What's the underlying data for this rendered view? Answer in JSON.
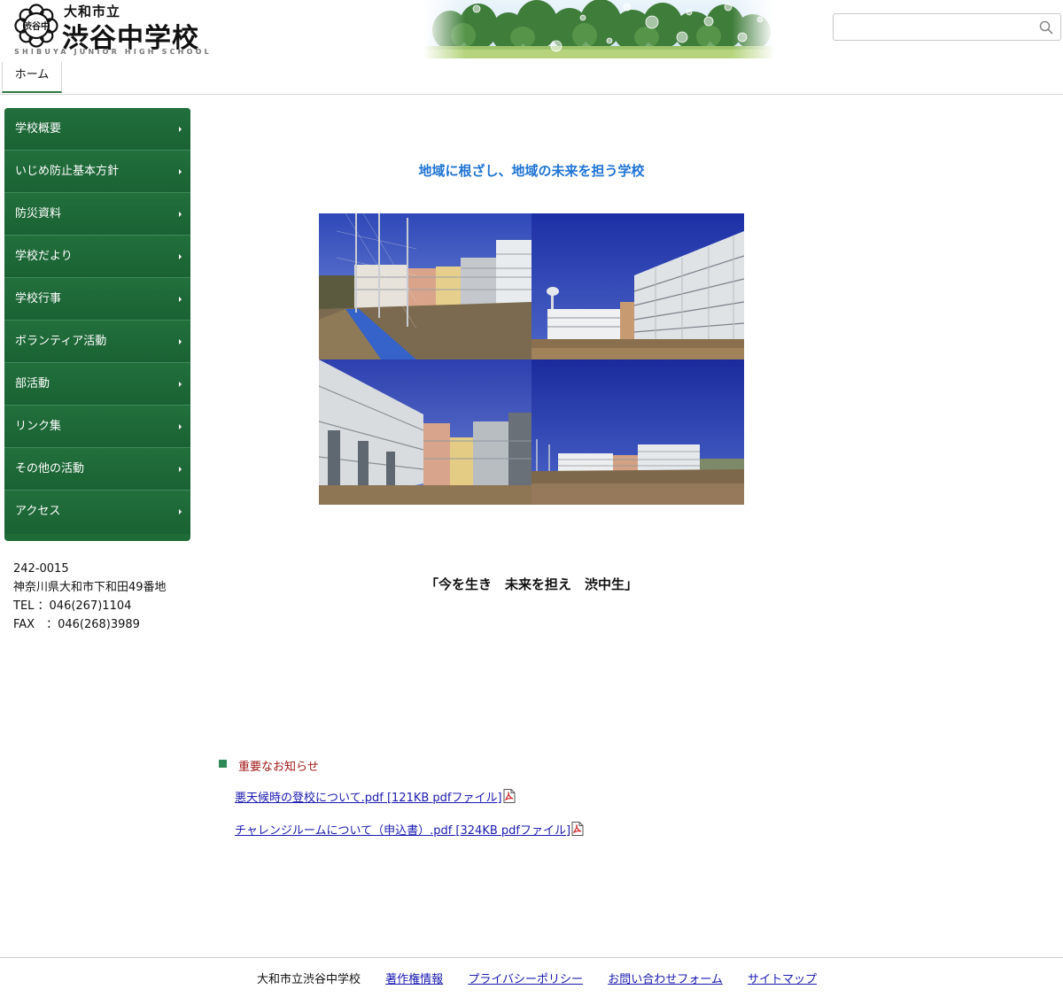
{
  "header": {
    "logo_city": "大和市立",
    "logo_school": "渋谷中学校",
    "logo_english": "SHIBUYA JUNIOR HIGH SCHOOL",
    "emblem_text": "渋谷中",
    "search_placeholder": "",
    "search_icon": "search-icon"
  },
  "nav": {
    "tabs": [
      {
        "label": "ホーム",
        "active": true
      }
    ]
  },
  "sidebar": {
    "items": [
      {
        "label": "学校概要"
      },
      {
        "label": "いじめ防止基本方針"
      },
      {
        "label": "防災資料"
      },
      {
        "label": "学校だより"
      },
      {
        "label": "学校行事"
      },
      {
        "label": "ボランティア活動"
      },
      {
        "label": "部活動"
      },
      {
        "label": "リンク集"
      },
      {
        "label": "その他の活動"
      },
      {
        "label": "アクセス"
      }
    ],
    "address": {
      "postal": "242-0015",
      "street": "神奈川県大和市下和田49番地",
      "tel": "TEL ：046(267)1104",
      "fax": "FAX　：046(268)3989"
    }
  },
  "main": {
    "tagline": "地域に根ざし、地域の未来を担う学校",
    "slogan": "「今を生き　未来を担え　渋中生」",
    "notices": {
      "heading": "重要なお知らせ",
      "links": [
        {
          "label": "悪天候時の登校について.pdf [121KB pdfファイル]"
        },
        {
          "label": "チャレンジルームについて（申込書）.pdf [324KB pdfファイル]"
        }
      ]
    }
  },
  "footer": {
    "school_name": "大和市立渋谷中学校",
    "links": [
      {
        "label": "著作権情報"
      },
      {
        "label": "プライバシーポリシー"
      },
      {
        "label": "お問い合わせフォーム"
      },
      {
        "label": "サイトマップ"
      }
    ]
  },
  "colors": {
    "menu_green": "#1e6b38",
    "tagline_blue": "#1f74d4",
    "notice_red": "#a01818",
    "link_blue": "#1a1ab0"
  }
}
